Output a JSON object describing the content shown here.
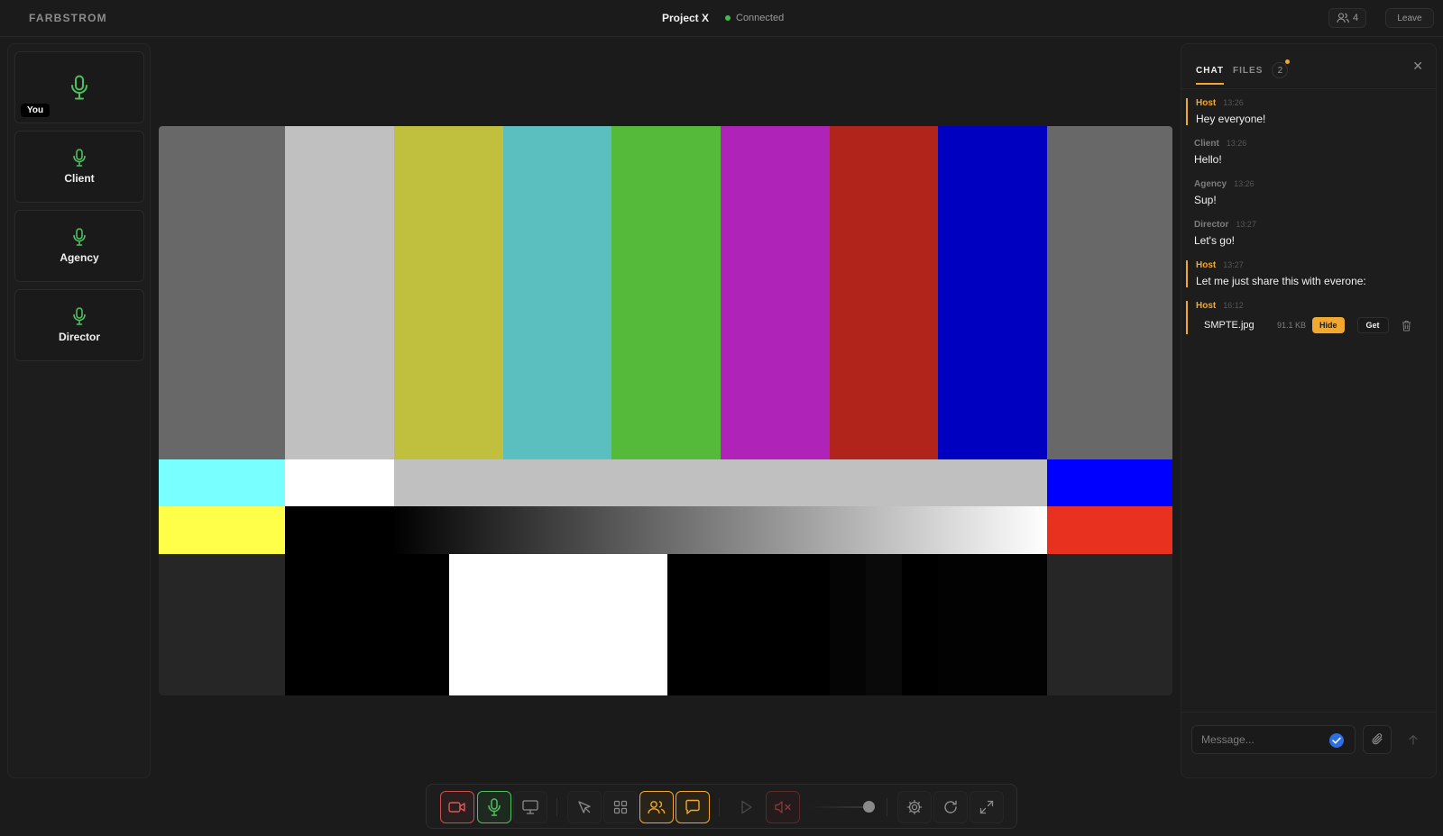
{
  "app": {
    "brand": "FARBSTROM",
    "project": "Project X",
    "status": "Connected",
    "participant_count": "4",
    "leave_label": "Leave"
  },
  "participants": [
    {
      "name": "",
      "tag": "You"
    },
    {
      "name": "Client"
    },
    {
      "name": "Agency"
    },
    {
      "name": "Director"
    }
  ],
  "chat": {
    "tabs": [
      {
        "label": "CHAT"
      },
      {
        "label": "FILES",
        "count": "2"
      }
    ],
    "messages": [
      {
        "author": "Host",
        "time": "13:26",
        "text": "Hey everyone!"
      },
      {
        "author": "Client",
        "time": "13:26",
        "text": "Hello!"
      },
      {
        "author": "Agency",
        "time": "13:26",
        "text": "Sup!"
      },
      {
        "author": "Director",
        "time": "13:27",
        "text": "Let's go!"
      },
      {
        "author": "Host",
        "time": "13:27",
        "text": "Let me just share this with everone:"
      },
      {
        "author": "Host",
        "time": "16:12",
        "file": {
          "name": "SMPTE.jpg",
          "size": "91.1 KB",
          "hide_label": "Hide",
          "get_label": "Get"
        }
      }
    ],
    "input_placeholder": "Message..."
  },
  "toolbar": {
    "buttons": [
      "camera-icon",
      "microphone-icon",
      "screen-share-icon",
      "pointer-icon",
      "grid-icon",
      "users-icon",
      "chat-icon",
      "play-icon",
      "mute-icon",
      "settings-icon",
      "refresh-icon",
      "fullscreen-icon"
    ]
  },
  "colors": {
    "accent": "#f0a830",
    "mic_active": "#4fbf5f",
    "camera_off": "#c8504f",
    "connected": "#3fbf4f"
  }
}
